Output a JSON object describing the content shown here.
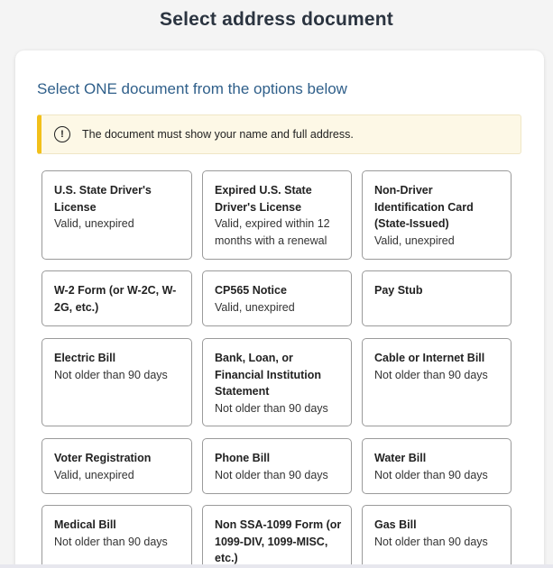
{
  "header": {
    "title": "Select address document"
  },
  "card": {
    "heading": "Select ONE document from the options below",
    "notice": {
      "icon": "alert-circle-icon",
      "text": "The document must show your name and full address."
    }
  },
  "options": [
    {
      "title": "U.S. State Driver's License",
      "subtitle": "Valid, unexpired"
    },
    {
      "title": "Expired U.S. State Driver's License",
      "subtitle": "Valid, expired within 12 months with a renewal"
    },
    {
      "title": "Non-Driver Identification Card (State-Issued)",
      "subtitle": "Valid, unexpired"
    },
    {
      "title": "W-2 Form (or W-2C, W-2G, etc.)",
      "subtitle": ""
    },
    {
      "title": "CP565 Notice",
      "subtitle": "Valid, unexpired"
    },
    {
      "title": "Pay Stub",
      "subtitle": ""
    },
    {
      "title": "Electric Bill",
      "subtitle": "Not older than 90 days"
    },
    {
      "title": "Bank, Loan, or Financial Institution Statement",
      "subtitle": "Not older than 90 days"
    },
    {
      "title": "Cable or Internet Bill",
      "subtitle": "Not older than 90 days"
    },
    {
      "title": "Voter Registration",
      "subtitle": "Valid, unexpired"
    },
    {
      "title": "Phone Bill",
      "subtitle": "Not older than 90 days"
    },
    {
      "title": "Water Bill",
      "subtitle": "Not older than 90 days"
    },
    {
      "title": "Medical Bill",
      "subtitle": "Not older than 90 days"
    },
    {
      "title": "Non SSA-1099 Form (or 1099-DIV, 1099-MISC, etc.)",
      "subtitle": ""
    },
    {
      "title": "Gas Bill",
      "subtitle": "Not older than 90 days"
    }
  ]
}
